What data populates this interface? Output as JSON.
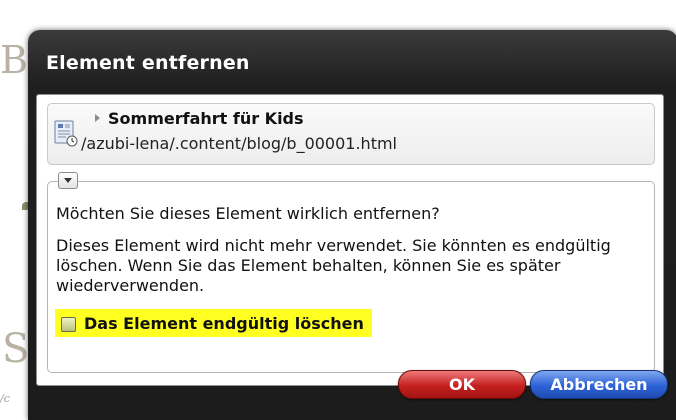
{
  "background": {
    "fragment_top": "B",
    "fragment_bottom": "S",
    "fragment_footer": "/c"
  },
  "dialog": {
    "title": "Element entfernen",
    "resource": {
      "icon": "xmlpage-resource-icon",
      "expand_icon": "triangle-right-icon",
      "title": "Sommerfahrt für Kids",
      "path": "/azubi-lena/.content/blog/b_00001.html"
    },
    "message": {
      "collapse_icon": "triangle-down-icon",
      "question": "Möchten Sie dieses Element wirklich entfernen?",
      "info": "Dieses Element wird nicht mehr verwendet. Sie könnten es endgültig löschen. Wenn Sie das Element behalten, können Sie es später wiederverwenden.",
      "delete_option": {
        "label": "Das Element endgültig löschen",
        "checked": false,
        "highlight_color": "#ffff22"
      }
    },
    "buttons": {
      "ok": "OK",
      "cancel": "Abbrechen"
    }
  },
  "colors": {
    "dialog_bg": "#1f1f1f",
    "ok_button": "#c52020",
    "cancel_button": "#2d62d6"
  }
}
